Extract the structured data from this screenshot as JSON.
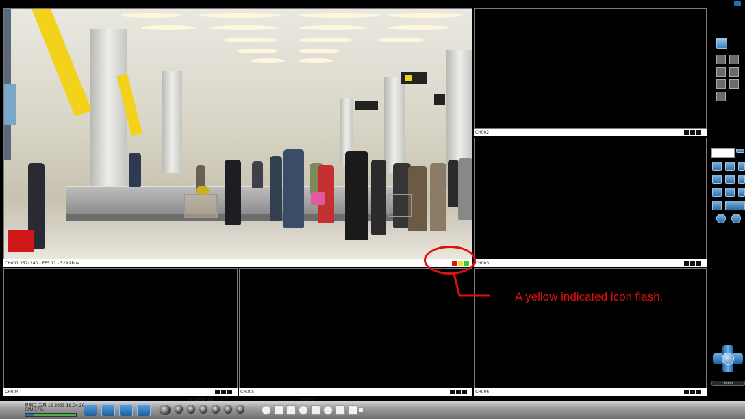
{
  "channels": {
    "ch1": {
      "label": "CH001 352x240 - FPS 11 - 529 kbps"
    },
    "ch2": {
      "label": "CH002"
    },
    "ch3": {
      "label": "CH003"
    },
    "ch4": {
      "label": "CH004"
    },
    "ch5": {
      "label": "CH005"
    },
    "ch6": {
      "label": "CH006"
    }
  },
  "annotation": {
    "text": "A yellow indicated icon flash."
  },
  "status": {
    "datetime": "星期二 五月 12 2009 18:34:26",
    "cpu": "CPU 17%",
    "cpu_usage": 0.17
  },
  "toolbar": {
    "sequence_label": "Sequence Tour",
    "setting_label": "Setting"
  },
  "ptz": {
    "zoom_label": "zoom"
  },
  "colors": {
    "background": "#000000",
    "annotation": "#e01010",
    "alarm_red": "#d01818",
    "indicator_yellow": "#f0e020",
    "indicator_green": "#33cc33",
    "button_blue": "#2d6fa8"
  },
  "icons": [
    "fullscreen-icon",
    "layout-icon",
    "play-icon",
    "snapshot-icon",
    "sequence-icon",
    "setting-icon",
    "speaker-icon",
    "ptz-joystick-icon"
  ]
}
